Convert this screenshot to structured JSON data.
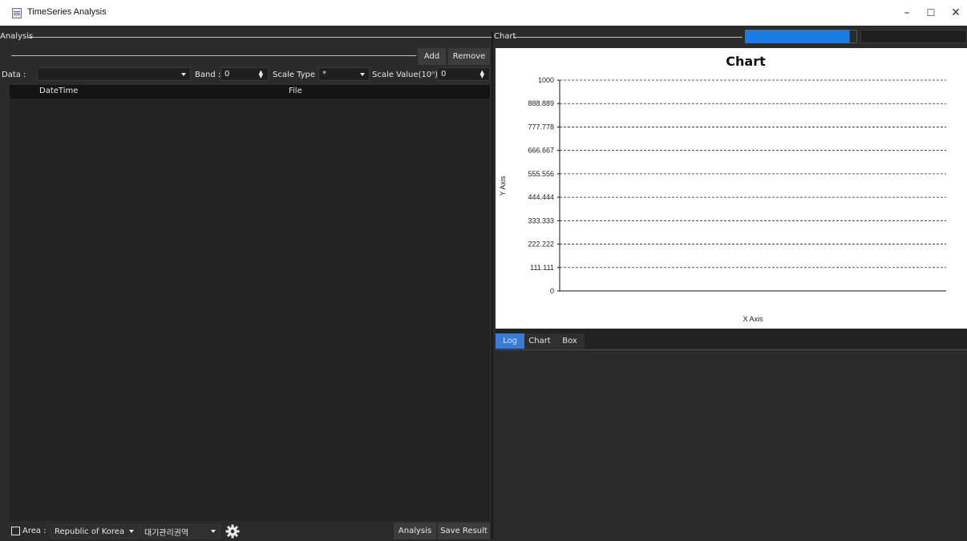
{
  "window": {
    "title": "TimeSeries Analysis",
    "minimize": "–",
    "maximize": "☐",
    "close": "✕"
  },
  "analysis": {
    "group_label": "Analysis",
    "add_label": "Add",
    "remove_label": "Remove",
    "data_label": "Data :",
    "data_value": "",
    "band_label": "Band :",
    "band_value": "0",
    "scale_type_label": "Scale Type :",
    "scale_type_value": "*",
    "scale_value_label": "Scale Value(10ⁿ) :",
    "scale_value": "0",
    "columns": [
      "DateTime",
      "File"
    ],
    "rows": []
  },
  "footer": {
    "area_label": "Area :",
    "area_checked": false,
    "country": "Republic of Korea",
    "region": "대기관리권역",
    "analysis_button": "Analysis",
    "save_button": "Save Result"
  },
  "chart_panel": {
    "group_label": "Chart",
    "selector_color": "#1a7ae6",
    "selector2_value": ""
  },
  "chart_data": {
    "type": "line",
    "title": "Chart",
    "xlabel": "X Axis",
    "ylabel": "Y Axis",
    "ylim": [
      0,
      1000
    ],
    "yticks": [
      "1000",
      "888.889",
      "777.778",
      "666.667",
      "555.556",
      "444.444",
      "333.333",
      "222.222",
      "111.111",
      "0"
    ],
    "grid": true,
    "series": []
  },
  "tabs": [
    "Log",
    "Chart",
    "Box"
  ],
  "active_tab": "Log",
  "colors": {
    "background": "#2b2b2b",
    "panel": "#232323",
    "accent": "#1a7ae6",
    "active_tab": "#3a7bd5"
  }
}
